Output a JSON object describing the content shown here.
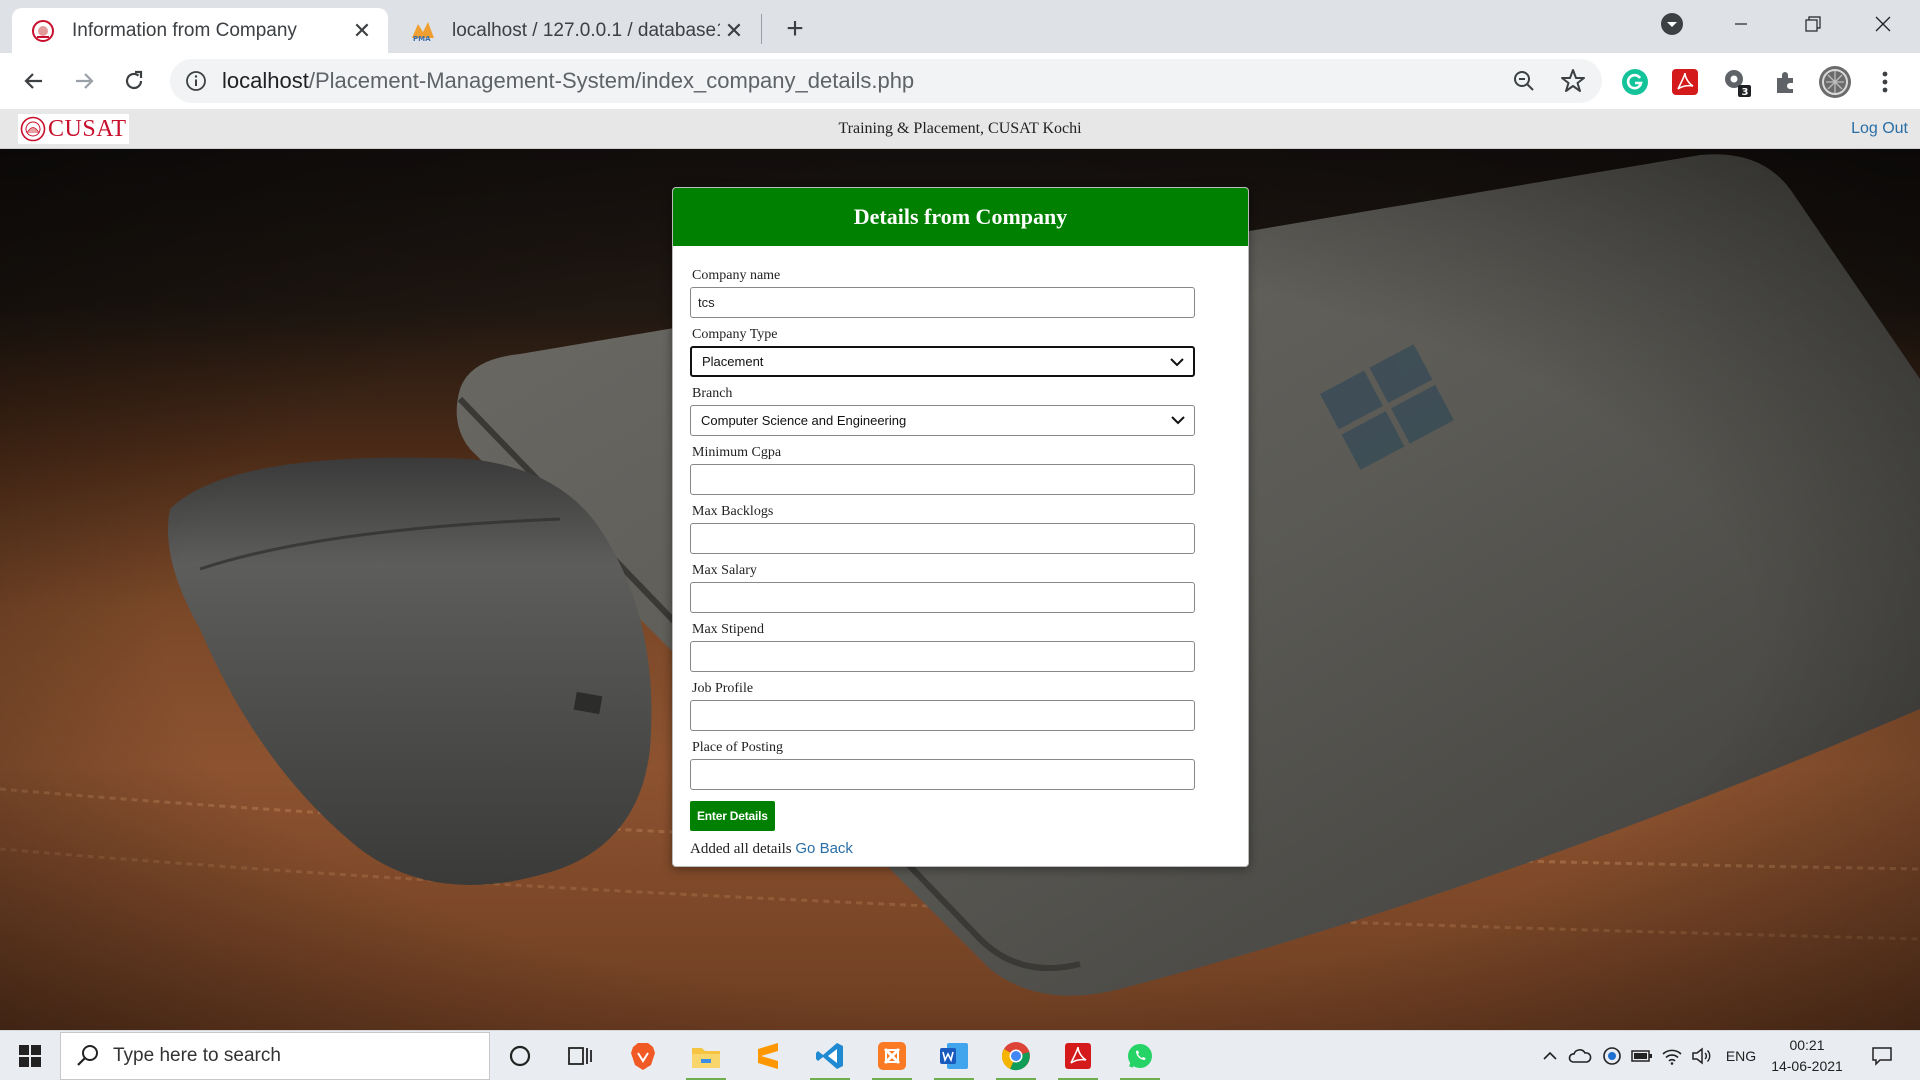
{
  "browser": {
    "tabs": [
      {
        "title": "Information from Company",
        "active": true,
        "favicon": "cusat-seal-icon"
      },
      {
        "title": "localhost / 127.0.0.1 / database1",
        "active": false,
        "favicon": "phpmyadmin-icon"
      }
    ],
    "url": {
      "host": "localhost",
      "path": "/Placement-Management-System/index_company_details.php"
    },
    "extension_badge": "3"
  },
  "header": {
    "logo_text": "CUSAT",
    "title": "Training & Placement, CUSAT Kochi",
    "logout": "Log Out"
  },
  "form": {
    "heading": "Details from Company",
    "fields": {
      "company_name": {
        "label": "Company name",
        "value": "tcs"
      },
      "company_type": {
        "label": "Company Type",
        "value": "Placement"
      },
      "branch": {
        "label": "Branch",
        "value": "Computer Science and Engineering"
      },
      "min_cgpa": {
        "label": "Minimum Cgpa",
        "value": ""
      },
      "max_backlogs": {
        "label": "Max Backlogs",
        "value": ""
      },
      "max_salary": {
        "label": "Max Salary",
        "value": ""
      },
      "max_stipend": {
        "label": "Max Stipend",
        "value": ""
      },
      "job_profile": {
        "label": "Job Profile",
        "value": ""
      },
      "place_of_posting": {
        "label": "Place of Posting",
        "value": ""
      }
    },
    "submit_label": "Enter Details",
    "status_text": "Added all details",
    "back_link": "Go Back"
  },
  "taskbar": {
    "search_placeholder": "Type here to search",
    "language": "ENG",
    "time": "00:21",
    "date": "14-06-2021"
  },
  "colors": {
    "form_header": "#008000",
    "submit_button": "#008000",
    "link": "#2a6ea6",
    "logo": "#c8102e"
  }
}
